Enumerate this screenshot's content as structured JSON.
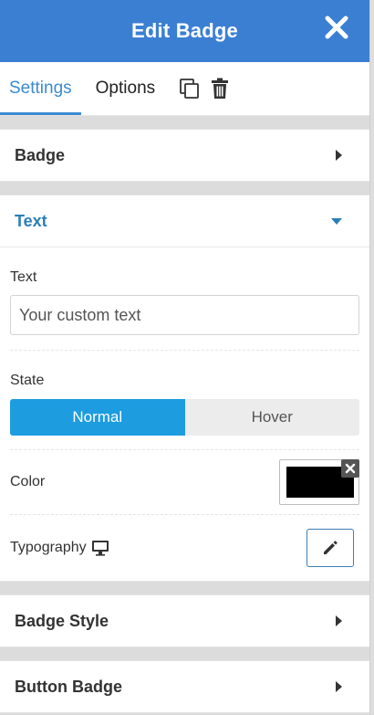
{
  "header": {
    "title": "Edit Badge"
  },
  "tabs": {
    "settings": "Settings",
    "options": "Options"
  },
  "sections": {
    "badge": "Badge",
    "text": "Text",
    "badge_style": "Badge Style",
    "button_badge": "Button Badge"
  },
  "text_section": {
    "text_label": "Text",
    "text_placeholder": "Your custom text",
    "state_label": "State",
    "state_normal": "Normal",
    "state_hover": "Hover",
    "color_label": "Color",
    "color_value": "#000000",
    "typography_label": "Typography"
  },
  "colors": {
    "accent": "#3b7fd3",
    "toggle_active": "#1d9ce0",
    "section_open": "#2a7fb8"
  },
  "icons": {
    "close": "close-icon",
    "duplicate": "duplicate-icon",
    "delete": "trash-icon",
    "desktop": "desktop-icon",
    "edit": "pencil-icon"
  }
}
